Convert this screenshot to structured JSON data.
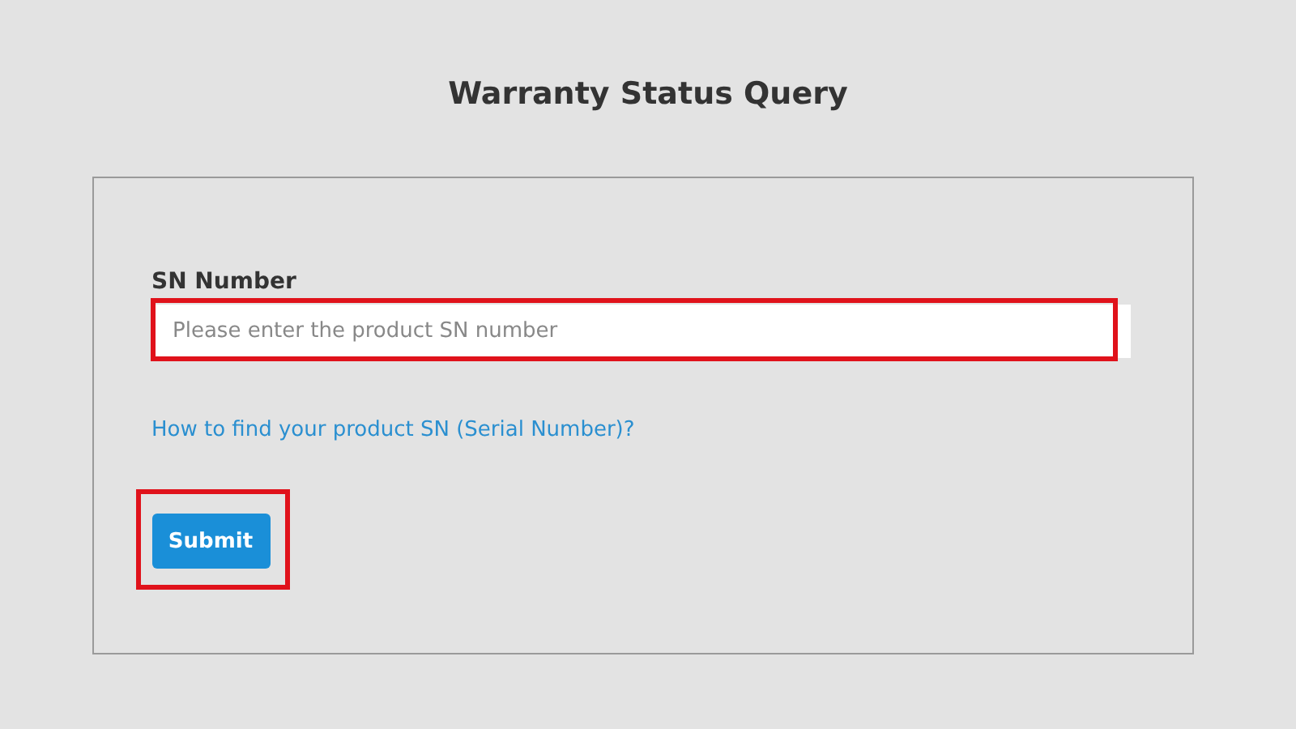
{
  "title": "Warranty Status Query",
  "form": {
    "field": {
      "label": "SN Number",
      "placeholder": "Please enter the product SN number",
      "highlighted": true
    },
    "help_link": "How to find your product SN (Serial Number)?",
    "submit": {
      "label": "Submit",
      "highlighted": true
    }
  }
}
